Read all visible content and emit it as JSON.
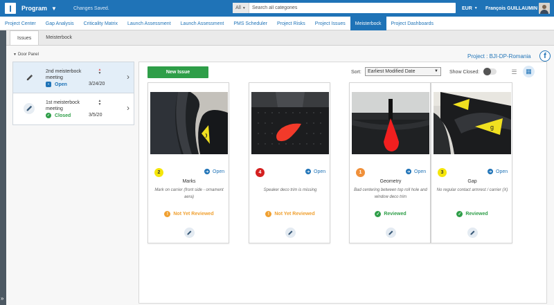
{
  "topbar": {
    "app_name": "Program",
    "saved_status": "Changes Saved.",
    "search_category": "All",
    "search_placeholder": "Search all categories",
    "currency": "EUR",
    "user_name": "François GUILLAUMIN"
  },
  "nav": {
    "tabs": [
      {
        "label": "Project Center"
      },
      {
        "label": "Gap Analysis"
      },
      {
        "label": "Criticality Matrix"
      },
      {
        "label": "Launch Assessment"
      },
      {
        "label": "Launch Assessment"
      },
      {
        "label": "PMS Scheduler"
      },
      {
        "label": "Project Risks"
      },
      {
        "label": "Project Issues"
      },
      {
        "label": "Meisterbock",
        "active": true
      },
      {
        "label": "Project Dashboards"
      }
    ]
  },
  "subtabs": {
    "issues": "Issues",
    "meisterbock": "Meisterbock"
  },
  "panel_label": "Door Panel",
  "project_label": "Project : BJI-DP-Romania",
  "meetings": [
    {
      "title": "2nd meisterbock meeting",
      "status": "Open",
      "date": "3/24/20"
    },
    {
      "title": "1st meisterbock meeting",
      "status": "Closed",
      "date": "3/5/20"
    }
  ],
  "toolbar": {
    "new_issue": "New Issue",
    "sort_label": "Sort:",
    "sort_value": "Earliest Modified Date",
    "show_closed": "Show Closed:",
    "show_closed_on": false
  },
  "cards": [
    {
      "badge": "2",
      "status": "Open",
      "title": "Marks",
      "desc": "Mark on carrier (front side - ornament aera)",
      "review": "Not Yet Reviewed",
      "badge_color": "#f5e60a",
      "badge_text_color": "#333333"
    },
    {
      "badge": "4",
      "status": "Open",
      "title": "",
      "desc": "Speaker deco trim is missing",
      "review": "Not Yet Reviewed",
      "badge_color": "#d42020",
      "badge_text_color": "#ffffff"
    },
    {
      "badge": "1",
      "status": "Open",
      "title": "Geometry",
      "desc": "Bad centering between top roll hole and window deco trim",
      "review": "Reviewed",
      "badge_color": "#f0903a",
      "badge_text_color": "#ffffff"
    },
    {
      "badge": "3",
      "status": "Open",
      "title": "Gap",
      "desc": "No regular contact armrest / carrier (X)",
      "review": "Reviewed",
      "badge_color": "#f5e60a",
      "badge_text_color": "#333333"
    }
  ],
  "colors": {
    "brand": "#1f73b7",
    "success": "#2e9e48",
    "warning": "#f0a030"
  }
}
